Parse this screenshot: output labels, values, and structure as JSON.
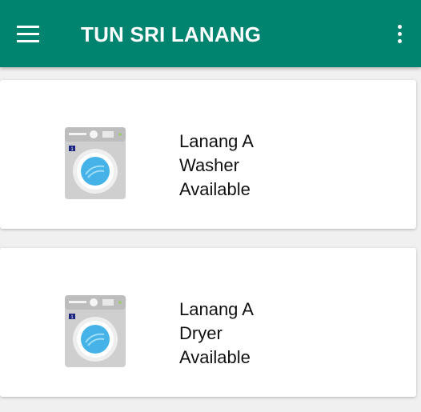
{
  "app_bar": {
    "title": "TUN SRI LANANG",
    "background_color": "#00846f",
    "menu_icon": "hamburger-menu-icon",
    "overflow_icon": "more-vertical-icon"
  },
  "machines": [
    {
      "name": "Lanang A",
      "type": "Washer",
      "status": "Available",
      "icon": "washing-machine-icon",
      "badge": "1"
    },
    {
      "name": "Lanang A",
      "type": "Dryer",
      "status": "Available",
      "icon": "washing-machine-icon",
      "badge": "1"
    }
  ]
}
